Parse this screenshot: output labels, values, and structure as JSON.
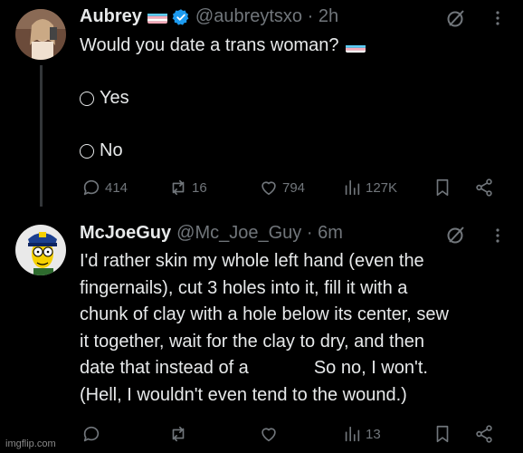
{
  "post1": {
    "name": "Aubrey",
    "handle": "@aubreytsxo · 2h",
    "question": "Would you date a trans woman?",
    "options": [
      "Yes",
      "No"
    ],
    "stats": {
      "replies": "414",
      "reposts": "16",
      "likes": "794",
      "views": "127K"
    }
  },
  "post2": {
    "name": "McJoeGuy",
    "handle": "@Mc_Joe_Guy · 6m",
    "lines": [
      "I'd rather skin my whole left hand (even the",
      "fingernails), cut 3 holes into it, fill it with a",
      "chunk of clay with a hole below its center, sew",
      "it together, wait for the clay to dry, and then"
    ],
    "line5_before": "date that instead of a",
    "line5_after": "So no, I won't.",
    "line6": "(Hell, I wouldn't even tend to the wound.)",
    "stats": {
      "views": "13"
    }
  },
  "watermark": "imgflip.com",
  "colors": {
    "background": "#000000",
    "text": "#e7e9ea",
    "muted": "#71767b",
    "verified": "#1d9bf0"
  }
}
